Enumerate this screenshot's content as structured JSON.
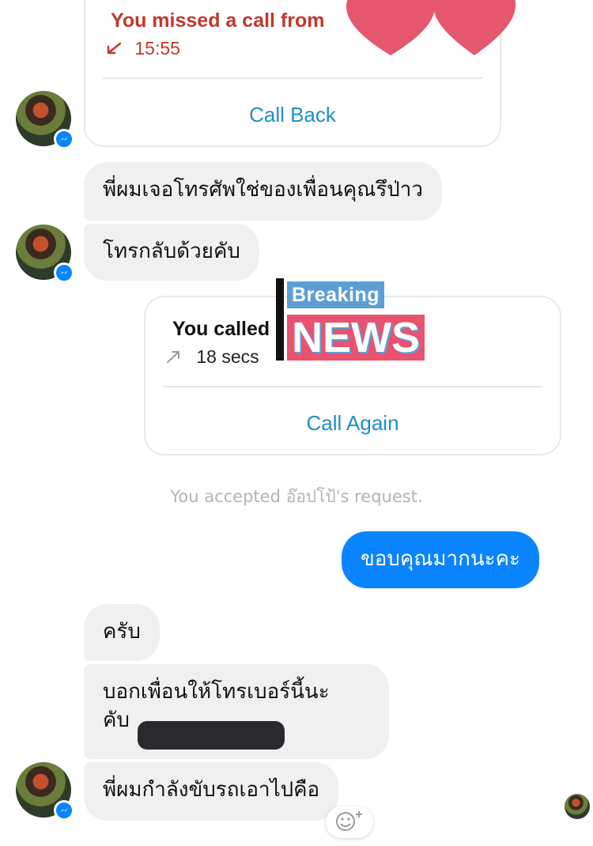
{
  "missed_call": {
    "title": "You missed a call from",
    "time": "15:55",
    "action": "Call Back"
  },
  "messages_received_1": [
    "พี่ผมเจอโทรศัพใช่ของเพื่อนคุณรึป่าว",
    "โทรกลับด้วยคับ"
  ],
  "outgoing_call": {
    "title": "You called",
    "duration": "18 secs",
    "action": "Call Again"
  },
  "overlay": {
    "breaking": "Breaking",
    "news": "NEWS"
  },
  "system_notice": "You accepted อ๊อปโป้'s request.",
  "sent_message": "ขอบคุณมากนะคะ",
  "messages_received_2": [
    "ครับ",
    "บอกเพื่อนให้โทรเบอร์นี้นะ",
    "คับ",
    "พี่ผมกำลังขับรถเอาไปคือ"
  ],
  "icons": {
    "missed": "missed-call-arrow-icon",
    "outgoing": "outgoing-call-arrow-icon",
    "messenger": "messenger-badge-icon",
    "reaction": "add-reaction-icon"
  },
  "colors": {
    "missed_red": "#c0392b",
    "link_blue": "#1f8ecb",
    "sent_bubble": "#0a84ff",
    "received_bubble": "#f1f0f0",
    "heart_pink": "#e5566f",
    "news_red": "#e8536f",
    "news_blue": "#5b9fd6"
  }
}
